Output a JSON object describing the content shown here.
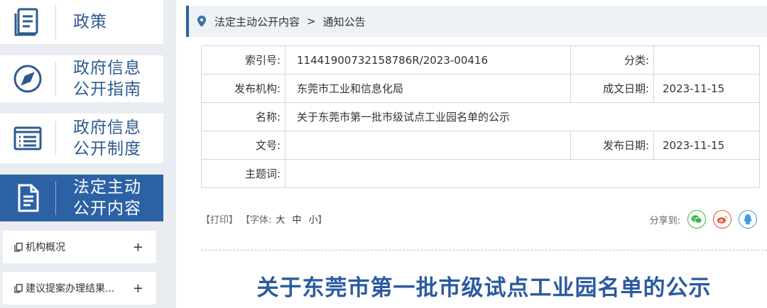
{
  "sidebar": {
    "nav": [
      {
        "label": "政策",
        "icon": "book-icon"
      },
      {
        "label": "政府信息公开指南",
        "icon": "compass-icon"
      },
      {
        "label": "政府信息公开制度",
        "icon": "list-icon"
      },
      {
        "label": "法定主动公开内容",
        "icon": "document-icon"
      }
    ],
    "nav_lines": [
      [
        "政策"
      ],
      [
        "政府信息",
        "公开指南"
      ],
      [
        "政府信息",
        "公开制度"
      ],
      [
        "法定主动",
        "公开内容"
      ]
    ],
    "sub": [
      {
        "label": "机构概况",
        "action": "+"
      },
      {
        "label": "建议提案办理结果...",
        "action": "+"
      }
    ]
  },
  "breadcrumb": {
    "items": [
      "法定主动公开内容",
      "通知公告"
    ],
    "separator": ">"
  },
  "meta": {
    "index_label": "索引号:",
    "index_value": "11441900732158786R/2023-00416",
    "category_label": "分类:",
    "category_value": "",
    "publisher_label": "发布机构:",
    "publisher_value": "东莞市工业和信息化局",
    "created_label": "成文日期:",
    "created_value": "2023-11-15",
    "name_label": "名称:",
    "name_value": "关于东莞市第一批市级试点工业园名单的公示",
    "docno_label": "文号:",
    "docno_value": "",
    "published_label": "发布日期:",
    "published_value": "2023-11-15",
    "subject_label": "主题词:",
    "subject_value": ""
  },
  "tools": {
    "print": "【打印】",
    "font_prefix": "【字体:",
    "large": "大",
    "medium": "中",
    "small": "小",
    "font_suffix": "】"
  },
  "share": {
    "label": "分享到:",
    "targets": [
      "wechat-icon",
      "weibo-icon",
      "qq-icon"
    ]
  },
  "article": {
    "title": "关于东莞市第一批市级试点工业园名单的公示"
  },
  "colors": {
    "accent": "#2c62a5",
    "title": "#2c5aa0",
    "wechat": "#3bb54a",
    "weibo": "#e8512f",
    "qq": "#3a9be0"
  }
}
